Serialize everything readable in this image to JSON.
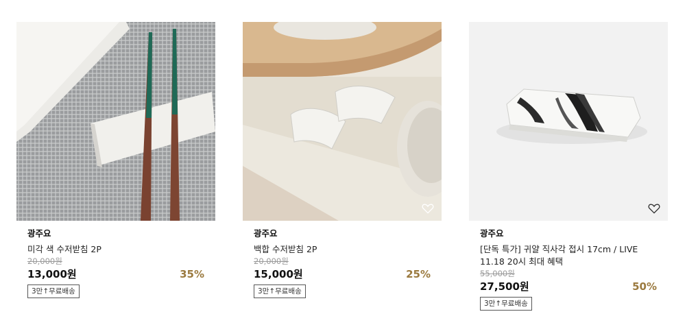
{
  "products": [
    {
      "brand": "광주요",
      "name": "미각 색 수저받침 2P",
      "original_price": "20,000원",
      "price": "13,000원",
      "discount": "35%",
      "shipping_badge": "3만↑무료배송",
      "wishlisted": false
    },
    {
      "brand": "광주요",
      "name": "백합 수저받침 2P",
      "original_price": "20,000원",
      "price": "15,000원",
      "discount": "25%",
      "shipping_badge": "3만↑무료배송",
      "wishlisted": false
    },
    {
      "brand": "광주요",
      "name": "[단독 특가] 귀얄 직사각 접시 17cm / LIVE 11.18 20시 최대 혜택",
      "original_price": "55,000원",
      "price": "27,500원",
      "discount": "50%",
      "shipping_badge": "3만↑무료배송",
      "wishlisted": false
    }
  ],
  "colors": {
    "discount": "#9b7a3f",
    "strikethrough": "#9a9a9a",
    "badge_border": "#555555"
  },
  "icons": {
    "wishlist": "heart-outline-icon"
  }
}
